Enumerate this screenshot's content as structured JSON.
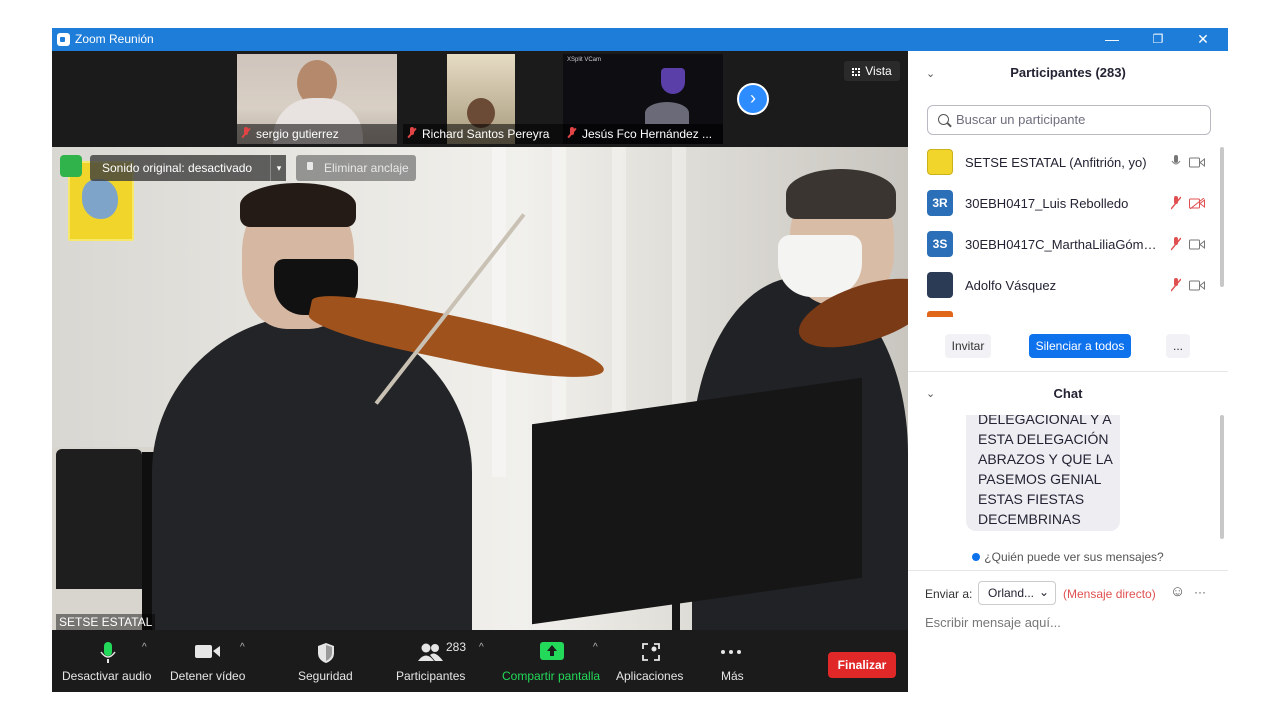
{
  "window": {
    "title": "Zoom Reunión",
    "minimize_glyph": "—",
    "restore_glyph": "❐",
    "close_glyph": "✕"
  },
  "thumbnails": [
    {
      "name": "sergio gutierrez"
    },
    {
      "name": "Richard Santos Pereyra"
    },
    {
      "name": "Jesús Fco Hernández ..."
    }
  ],
  "thumbnail_overlay_text": "XSplit VCam",
  "next_glyph": "›",
  "view_button": "Vista",
  "main_video": {
    "original_audio": "Sonido original: desactivado",
    "caret": "▾",
    "unpin": "Eliminar anclaje",
    "speaker": "SETSE ESTATAL"
  },
  "toolbar": {
    "mute": "Desactivar audio",
    "video": "Detener vídeo",
    "security": "Seguridad",
    "participants": "Participantes",
    "participants_count": "283",
    "share": "Compartir pantalla",
    "apps": "Aplicaciones",
    "more": "Más",
    "caret": "^",
    "end": "Finalizar"
  },
  "participants_panel": {
    "title": "Participantes (283)",
    "chevron": "⌄",
    "search_placeholder": "Buscar un participante",
    "items": [
      {
        "name": "SETSE ESTATAL (Anfitrión, yo)",
        "initials": "",
        "mic": "on",
        "video": "on"
      },
      {
        "name": "30EBH0417_Luis Rebolledo",
        "initials": "3R",
        "mic": "muted",
        "video": "off"
      },
      {
        "name": "30EBH0417C_MarthaLiliaGómez...",
        "initials": "3S",
        "mic": "muted",
        "video": "on"
      },
      {
        "name": "Adolfo Vásquez",
        "initials": "",
        "mic": "muted",
        "video": "on"
      }
    ],
    "invite": "Invitar",
    "mute_all": "Silenciar a todos",
    "more": "..."
  },
  "chat": {
    "title": "Chat",
    "chevron": "⌄",
    "message": "DELEGACIONAL Y A\nESTA DELEGACIÓN\nABRAZOS Y QUE LA\nPASEMOS GENIAL\nESTAS FIESTAS\nDECEMBRINAS",
    "who_can_see": "¿Quién puede ver sus mensajes?",
    "send_to_label": "Enviar a:",
    "recipient": "Orland...",
    "recipient_caret": "⌄",
    "direct_label": "(Mensaje directo)",
    "emoji_glyph": "☺",
    "more_glyph": "···",
    "input_placeholder": "Escribir mensaje aquí..."
  },
  "colors": {
    "accent": "#2d8cff",
    "titlebar": "#1e7dd8",
    "end": "#e02828",
    "share": "#23d959",
    "mute_red": "#e04444"
  }
}
